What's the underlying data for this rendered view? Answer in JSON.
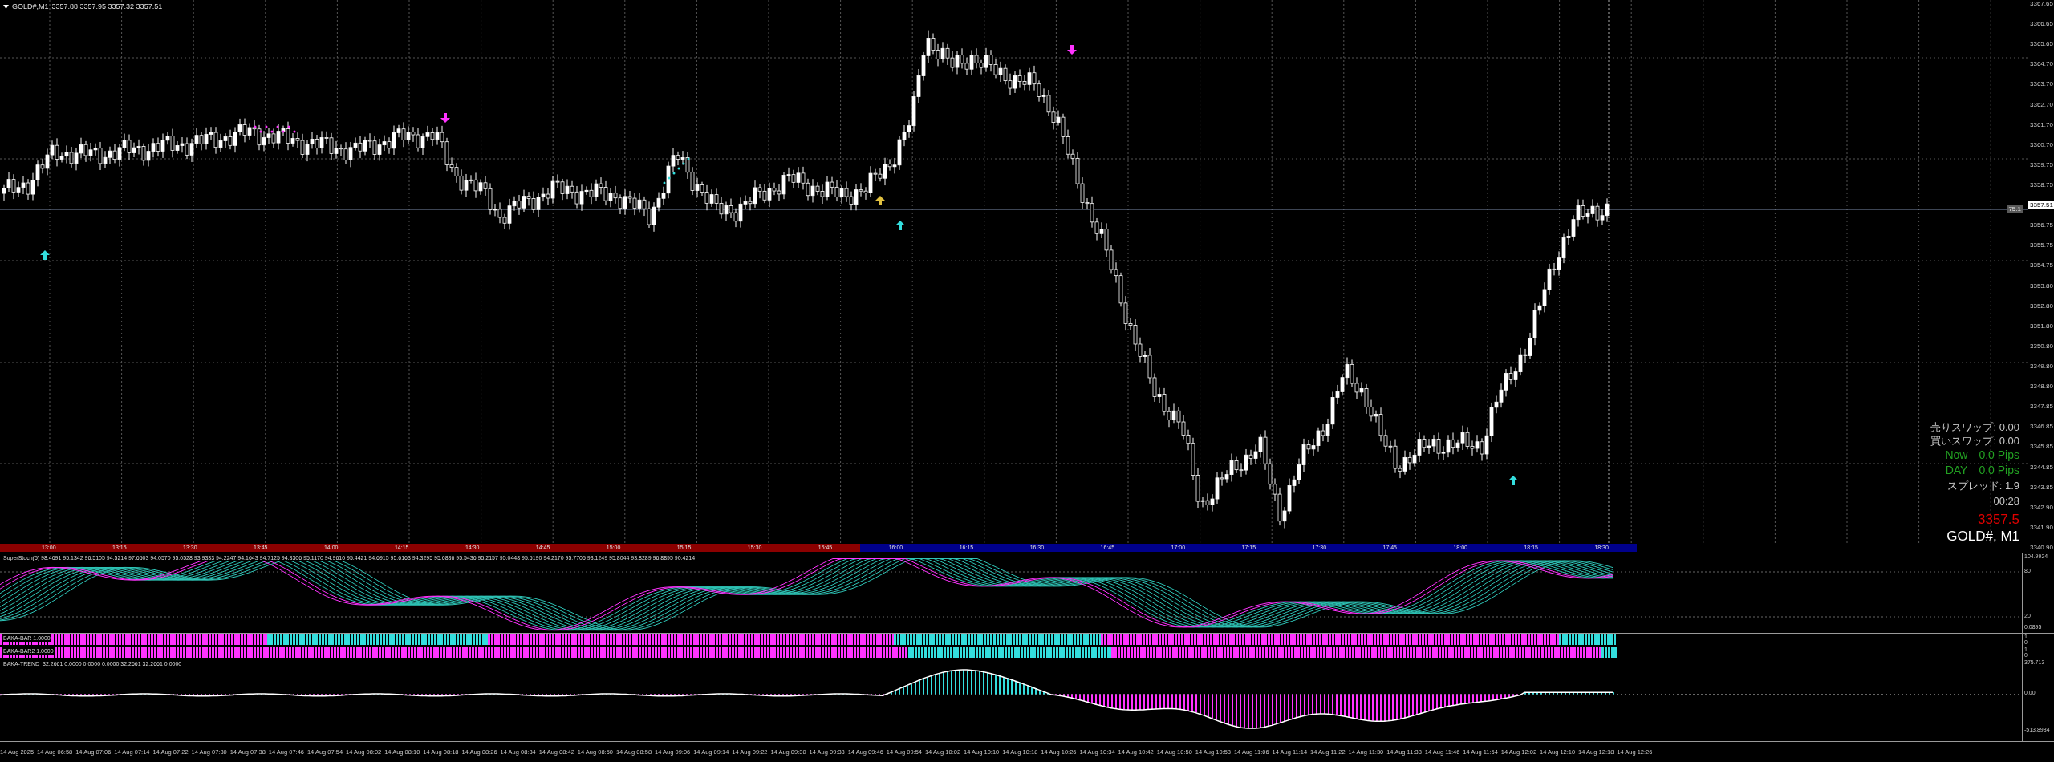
{
  "chart_header": {
    "symbol": "GOLD#,M1",
    "ohlc": "3357.88 3357.95 3357.32 3357.51"
  },
  "price_axis": {
    "labels": [
      {
        "text": "3367.65",
        "kind": "tick"
      },
      {
        "text": "3366.65",
        "kind": "tick"
      },
      {
        "text": "3365.65",
        "kind": "tick"
      },
      {
        "text": "3364.70",
        "kind": "tick"
      },
      {
        "text": "3363.70",
        "kind": "tick"
      },
      {
        "text": "3362.70",
        "kind": "tick"
      },
      {
        "text": "3361.70",
        "kind": "tick"
      },
      {
        "text": "3360.70",
        "kind": "tick"
      },
      {
        "text": "3359.75",
        "kind": "tick"
      },
      {
        "text": "3358.75",
        "kind": "tick"
      },
      {
        "text": "3357.51",
        "kind": "current"
      },
      {
        "text": "3356.75",
        "kind": "tick"
      },
      {
        "text": "3355.75",
        "kind": "tick"
      },
      {
        "text": "3354.75",
        "kind": "tick"
      },
      {
        "text": "3353.80",
        "kind": "tick"
      },
      {
        "text": "3352.80",
        "kind": "tick"
      },
      {
        "text": "3351.80",
        "kind": "tick"
      },
      {
        "text": "3350.80",
        "kind": "tick"
      },
      {
        "text": "3349.80",
        "kind": "tick"
      },
      {
        "text": "3348.80",
        "kind": "tick"
      },
      {
        "text": "3347.85",
        "kind": "tick"
      },
      {
        "text": "3346.85",
        "kind": "tick"
      },
      {
        "text": "3345.85",
        "kind": "tick"
      },
      {
        "text": "3344.85",
        "kind": "tick"
      },
      {
        "text": "3343.85",
        "kind": "tick"
      },
      {
        "text": "3342.90",
        "kind": "tick"
      },
      {
        "text": "3341.90",
        "kind": "tick"
      },
      {
        "text": "3340.90",
        "kind": "tick"
      }
    ],
    "line_label": "75.1"
  },
  "info_panel": {
    "sell_swap": "売りスワップ: 0.00",
    "buy_swap": "買いスワップ: 0.00",
    "now": {
      "label": "Now",
      "value": "0.0 Pips"
    },
    "day": {
      "label": "DAY",
      "value": "0.0 Pips"
    },
    "spread": "スプレッド: 1.9",
    "timer": "00:28",
    "price": "3357.5",
    "symbol": "GOLD#, M1"
  },
  "session_bar": [
    {
      "text": "13:00",
      "color": "#8b0000"
    },
    {
      "text": "13:15",
      "color": "#8b0000"
    },
    {
      "text": "13:30",
      "color": "#8b0000"
    },
    {
      "text": "13:45",
      "color": "#8b0000"
    },
    {
      "text": "14:00",
      "color": "#8b0000"
    },
    {
      "text": "14:15",
      "color": "#8b0000"
    },
    {
      "text": "14:30",
      "color": "#8b0000"
    },
    {
      "text": "14:45",
      "color": "#8b0000"
    },
    {
      "text": "15:00",
      "color": "#8b0000"
    },
    {
      "text": "15:15",
      "color": "#8b0000"
    },
    {
      "text": "15:30",
      "color": "#8b0000"
    },
    {
      "text": "15:45",
      "color": "#8b0000"
    },
    {
      "text": "16:00",
      "color": "#00008b"
    },
    {
      "text": "16:15",
      "color": "#00008b"
    },
    {
      "text": "16:30",
      "color": "#00008b"
    },
    {
      "text": "16:45",
      "color": "#00008b"
    },
    {
      "text": "17:00",
      "color": "#00008b"
    },
    {
      "text": "17:15",
      "color": "#00008b"
    },
    {
      "text": "17:30",
      "color": "#00008b"
    },
    {
      "text": "17:45",
      "color": "#00008b"
    },
    {
      "text": "18:00",
      "color": "#00008b"
    },
    {
      "text": "18:15",
      "color": "#00008b"
    },
    {
      "text": "18:30",
      "color": "#00008b"
    }
  ],
  "indicators": [
    {
      "kind": "stoch",
      "label": "SuperStoch(5) 98.4691 95.1342 96.5105 94.5214 97.6503 94.0570 95.0528 93.9333 94.2247 94.1643 94.7125 94.3306 95.1170 94.9610 95.4421 94.6915 95.6163 94.3295 95.6836 95.5436 95.2157 95.0448 95.5190 94.2170 95.7705 93.1249 95.8044 93.8289 96.8895 90.4214",
      "axis": [
        "104.9924",
        "80",
        "20",
        "0.0895"
      ]
    },
    {
      "kind": "bar",
      "label": "BAKA-BAR 1.0000",
      "axis": [
        "1",
        "0"
      ]
    },
    {
      "kind": "bar2",
      "label": "BAKA-BAR2 1.0000",
      "axis": [
        "1",
        "0"
      ]
    },
    {
      "kind": "trend",
      "label": "BAKA-TREND  32.2661 0.0000 0.0000 0.0000 32.2661 32.2661 0.0000",
      "axis": [
        "375.713",
        "0.00",
        "-513.8984"
      ]
    }
  ],
  "time_axis": [
    "14 Aug 2025",
    "14 Aug 06:58",
    "14 Aug 07:06",
    "14 Aug 07:14",
    "14 Aug 07:22",
    "14 Aug 07:30",
    "14 Aug 07:38",
    "14 Aug 07:46",
    "14 Aug 07:54",
    "14 Aug 08:02",
    "14 Aug 08:10",
    "14 Aug 08:18",
    "14 Aug 08:26",
    "14 Aug 08:34",
    "14 Aug 08:42",
    "14 Aug 08:50",
    "14 Aug 08:58",
    "14 Aug 09:06",
    "14 Aug 09:14",
    "14 Aug 09:22",
    "14 Aug 09:30",
    "14 Aug 09:38",
    "14 Aug 09:46",
    "14 Aug 09:54",
    "14 Aug 10:02",
    "14 Aug 10:10",
    "14 Aug 10:18",
    "14 Aug 10:26",
    "14 Aug 10:34",
    "14 Aug 10:42",
    "14 Aug 10:50",
    "14 Aug 10:58",
    "14 Aug 11:06",
    "14 Aug 11:14",
    "14 Aug 11:22",
    "14 Aug 11:30",
    "14 Aug 11:38",
    "14 Aug 11:46",
    "14 Aug 11:54",
    "14 Aug 12:02",
    "14 Aug 12:10",
    "14 Aug 12:18",
    "14 Aug 12:26"
  ]
}
